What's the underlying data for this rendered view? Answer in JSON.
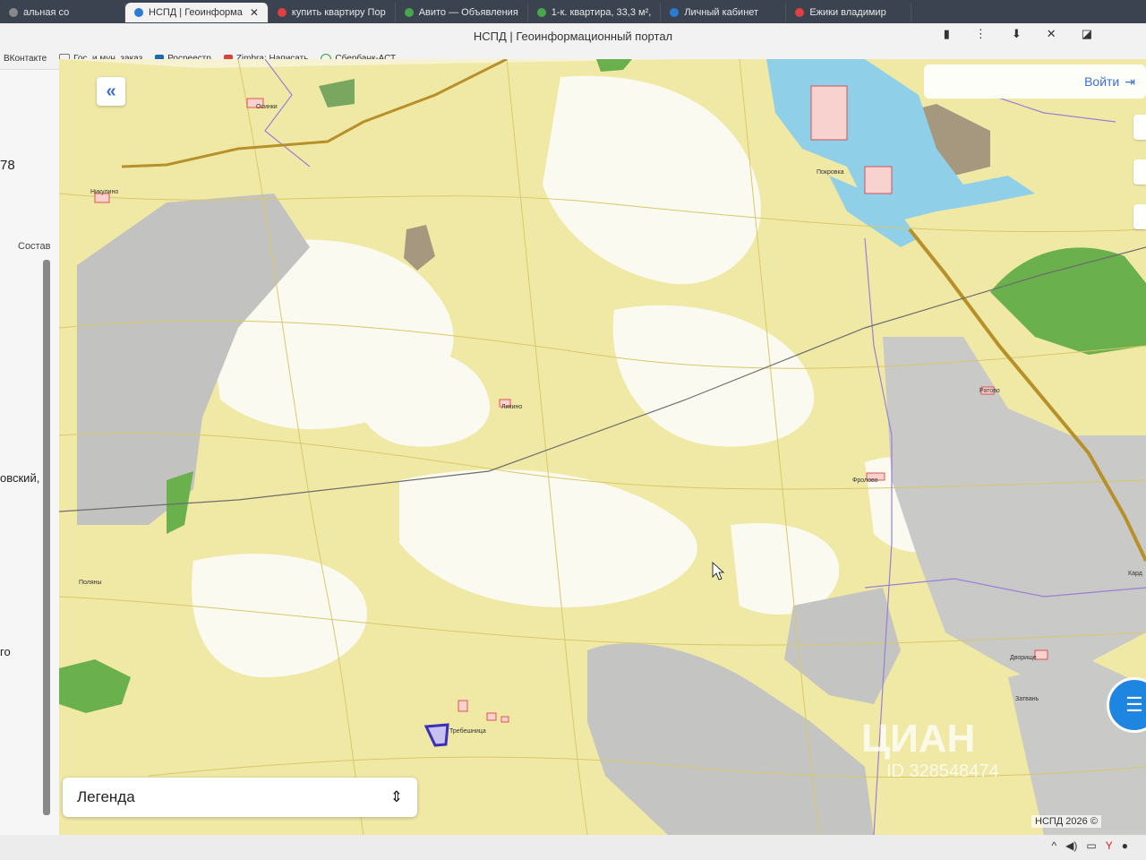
{
  "browser": {
    "tabs": [
      {
        "label": "альная со",
        "active": false,
        "color": "#888888"
      },
      {
        "label": "НСПД | Геоинформа",
        "active": true,
        "color": "#2a7bd4"
      },
      {
        "label": "купить квартиру Пор",
        "active": false,
        "color": "#e04040"
      },
      {
        "label": "Авито — Объявления",
        "active": false,
        "color": "#46a84a"
      },
      {
        "label": "1-к. квартира, 33,3 м²,",
        "active": false,
        "color": "#46a84a"
      },
      {
        "label": "Личный кабинет",
        "active": false,
        "color": "#2a7bd4"
      },
      {
        "label": "Ежики владимир",
        "active": false,
        "color": "#e04040"
      }
    ],
    "window_title": "НСПД | Геоинформационный портал",
    "bookmarks": [
      {
        "label": "ВКонтакте",
        "icon": "vk-icon"
      },
      {
        "label": "Гос. и мун. заказ",
        "icon": "page-icon"
      },
      {
        "label": "Росреестр",
        "icon": "rosreestr-icon"
      },
      {
        "label": "Zimbra: Написать",
        "icon": "zimbra-icon"
      },
      {
        "label": "Сбербанк-АСТ",
        "icon": "sber-icon"
      }
    ]
  },
  "sidebar": {
    "number_fragment": "78",
    "composition_label": "Состав",
    "text_fragment_1": "овский,",
    "text_fragment_2": "го"
  },
  "map": {
    "login_label": "Войти",
    "legend_label": "Легенда",
    "copyright": "НСПД 2026 ©",
    "watermark": "ЦИАН",
    "watermark_id": "ID 328548474",
    "places": [
      "Осинки",
      "Никулино",
      "Поляны",
      "Требешница",
      "Фролово",
      "Ратово",
      "Дворище",
      "Затвань",
      "Кард",
      "Ликино",
      "Покровка"
    ]
  },
  "colors": {
    "field_yellow": "#f0e9a6",
    "forest_gray": "#bdbdbd",
    "green": "#6ab04c",
    "water": "#8fd0e8",
    "brown": "#a6977f",
    "accent_blue": "#3b6fd0"
  }
}
